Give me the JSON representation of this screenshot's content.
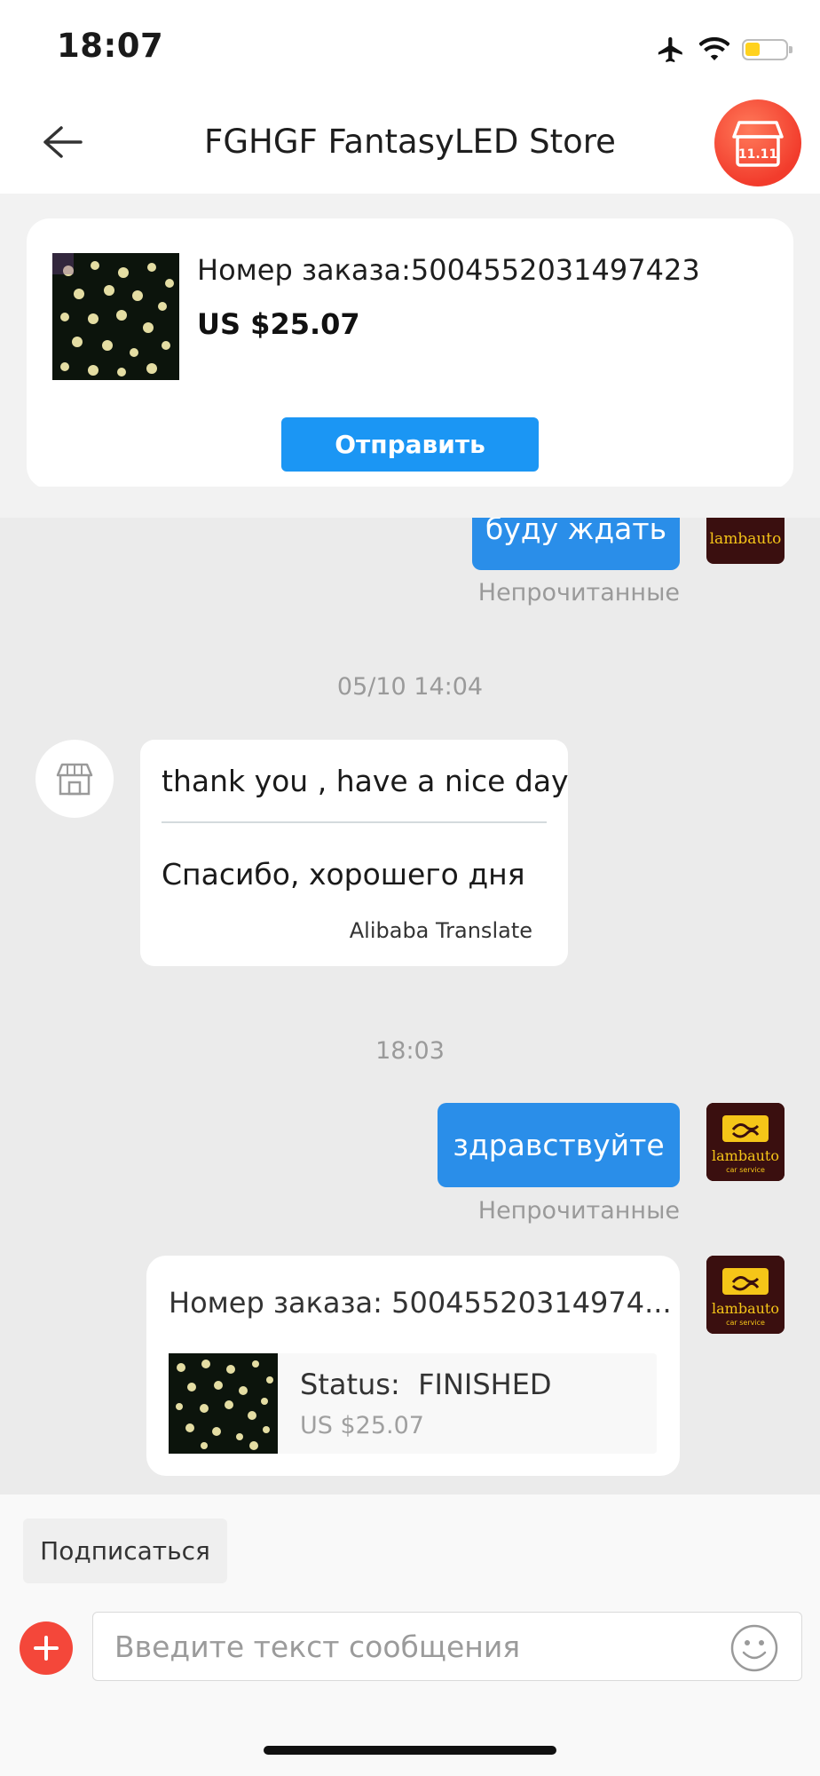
{
  "status_bar": {
    "time": "18:07"
  },
  "header": {
    "title": "FGHGF FantasyLED Store",
    "store_badge": "11.11"
  },
  "order_card": {
    "number_label": "Номер заказа:5004552031497423",
    "price": "US $25.07",
    "send_label": "Отправить"
  },
  "messages": {
    "out_1": {
      "text": "буду ждать",
      "status": "Непрочитанные"
    },
    "ts_1": "05/10 14:04",
    "in_1": {
      "original": "thank you , have a nice day",
      "translated": "Спасибо, хорошего дня",
      "provider": "Alibaba Translate"
    },
    "ts_2": "18:03",
    "out_2": {
      "text": "здравствуйте",
      "status": "Непрочитанные"
    },
    "order_msg": {
      "title": "Номер заказа: 50045520314974...",
      "status_label": "Status:",
      "status_value": "FINISHED",
      "price": "US $25.07"
    }
  },
  "avatar": {
    "brand": "lambauto",
    "tagline": "car service"
  },
  "bottom": {
    "subscribe_label": "Подписаться",
    "input_placeholder": "Введите текст сообщения"
  },
  "colors": {
    "accent_blue": "#1b96f4",
    "bubble_blue": "#2a8ee9",
    "red": "#f4473a",
    "avatar_bg": "#3a0f0f",
    "logo_yellow": "#f5c518"
  }
}
